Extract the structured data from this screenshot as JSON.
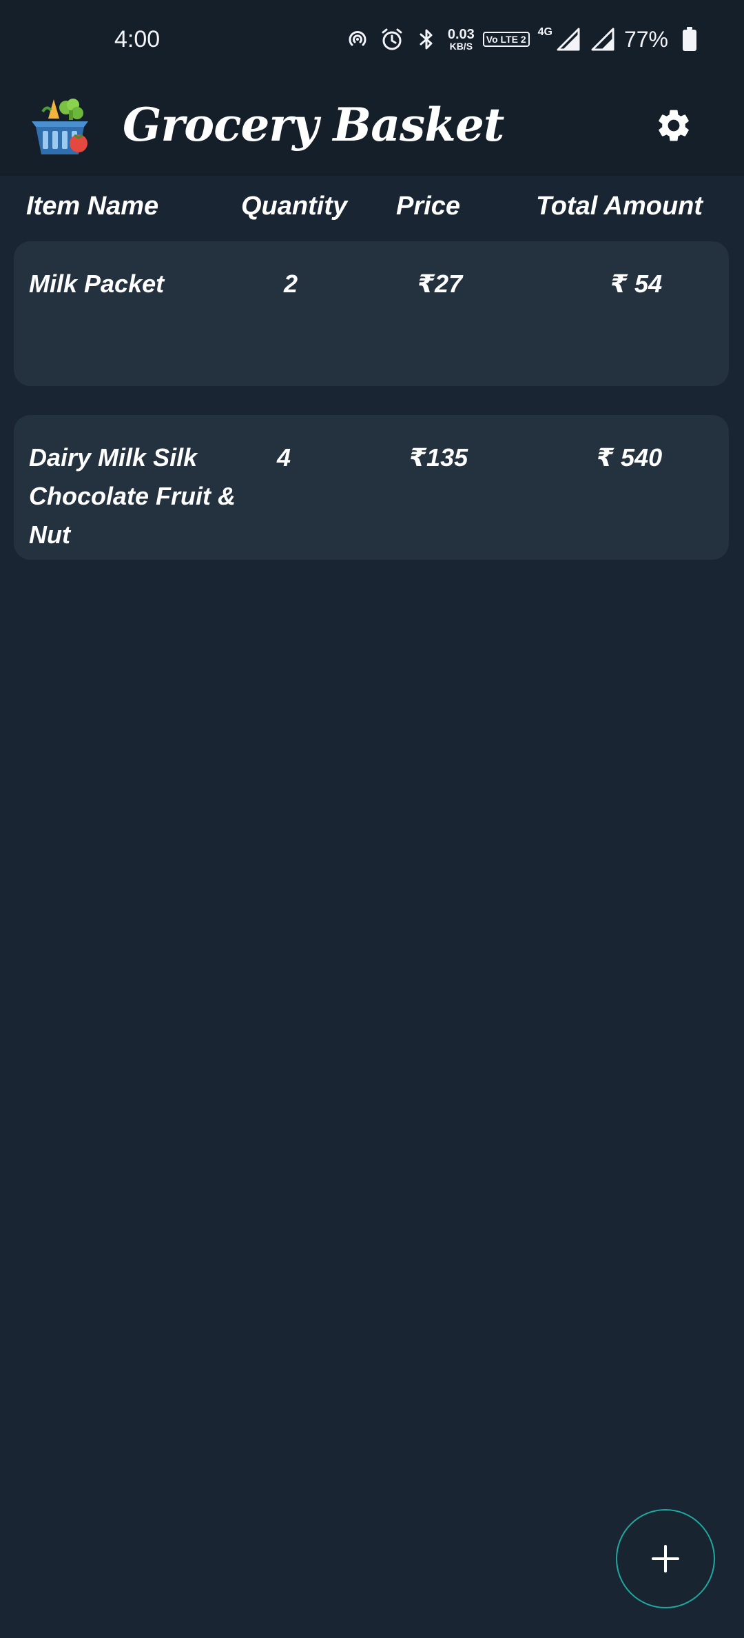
{
  "status_bar": {
    "time": "4:00",
    "net_speed_value": "0.03",
    "net_speed_unit": "KB/S",
    "volte_label": "Vo LTE 2",
    "network_type": "4G",
    "battery_percent": "77%",
    "icons": [
      "hotspot-icon",
      "alarm-icon",
      "bluetooth-icon",
      "volte-icon",
      "signal-icon",
      "signal-icon",
      "battery-icon"
    ]
  },
  "app_bar": {
    "title": "Grocery Basket",
    "logo_icon": "grocery-basket-icon",
    "settings_icon": "gear-icon"
  },
  "columns": {
    "item_name": "Item Name",
    "quantity": "Quantity",
    "price": "Price",
    "total_amount": "Total Amount"
  },
  "items": [
    {
      "name": "Milk Packet",
      "quantity": "2",
      "price": "₹27",
      "total": "₹ 54"
    },
    {
      "name": "Dairy Milk Silk Chocolate Fruit & Nut",
      "quantity": "4",
      "price": "₹135",
      "total": "₹ 540"
    }
  ],
  "fab": {
    "icon": "plus-icon",
    "accent_color": "#1fa99e"
  },
  "colors": {
    "background": "#1a2533",
    "app_bar": "#151f2a",
    "card": "#24313e",
    "text": "#ffffff"
  }
}
